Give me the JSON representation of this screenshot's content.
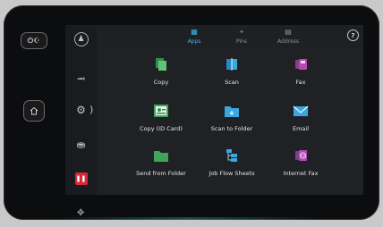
{
  "hardware": {
    "power_label": "⏻☪",
    "home_icon": "home-icon"
  },
  "sidebar": {
    "user_icon": "♟",
    "jobs_icon": "⭲",
    "settings_icon": "⚙",
    "settings_chevron": ")",
    "toner_icon": "⛂",
    "stop_icon": "❚❚",
    "stop_color": "#d6283b"
  },
  "tabs": [
    {
      "label": "Apps",
      "icon": "▦",
      "active": true
    },
    {
      "label": "Pins",
      "icon": "⌖",
      "active": false
    },
    {
      "label": "Address",
      "icon": "▤",
      "active": false
    }
  ],
  "help_label": "?",
  "more_label": "⋮",
  "apps": [
    {
      "label": "Copy",
      "color": "#3fa55a"
    },
    {
      "label": "Scan",
      "color": "#3aa7e0"
    },
    {
      "label": "Fax",
      "color": "#b14bb3"
    },
    {
      "label": "Copy (ID Card)",
      "color": "#3fa55a"
    },
    {
      "label": "Scan to Folder",
      "color": "#3aa7e0"
    },
    {
      "label": "Email",
      "color": "#3aa7e0"
    },
    {
      "label": "Send from Folder",
      "color": "#3fa55a"
    },
    {
      "label": "Job Flow Sheets",
      "color": "#3aa7e0"
    },
    {
      "label": "Internet Fax",
      "color": "#b14bb3"
    }
  ],
  "bottom_icon": "✥"
}
